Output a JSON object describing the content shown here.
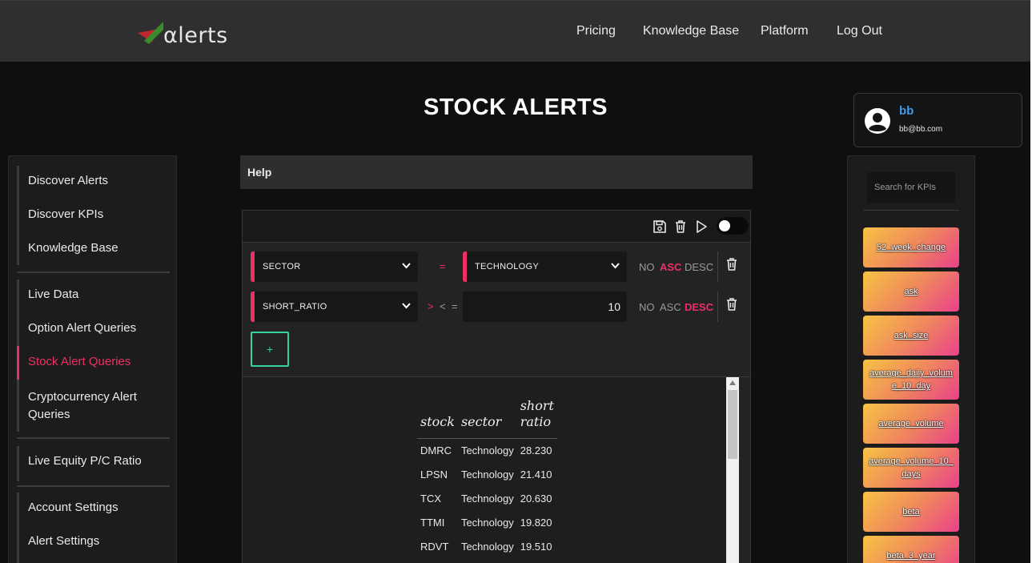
{
  "brand": {
    "logo_text": "αlerts"
  },
  "topnav": [
    "Pricing",
    "Knowledge Base",
    "Platform",
    "Log Out"
  ],
  "page": {
    "title": "STOCK ALERTS"
  },
  "user": {
    "name": "bb",
    "email": "bb@bb.com"
  },
  "sidebar": {
    "group1": [
      "Discover Alerts",
      "Discover KPIs",
      "Knowledge Base"
    ],
    "group2": [
      "Live Data",
      "Option Alert Queries",
      "Stock Alert Queries",
      "Cryptocurrency Alert Queries"
    ],
    "group3": [
      "Live Equity P/C Ratio"
    ],
    "group4": [
      "Account Settings",
      "Alert Settings"
    ],
    "active": "Stock Alert Queries"
  },
  "help": {
    "label": "Help"
  },
  "query": {
    "rows": [
      {
        "field": "SECTOR",
        "operators": [
          "="
        ],
        "active_operator": "=",
        "value": "TECHNOLOGY",
        "sort": [
          "NO",
          "ASC",
          "DESC"
        ],
        "active_sort": "ASC"
      },
      {
        "field": "SHORT_RATIO",
        "operators": [
          ">",
          "<",
          "="
        ],
        "active_operator": ">",
        "value": "10",
        "sort": [
          "NO",
          "ASC",
          "DESC"
        ],
        "active_sort": "DESC"
      }
    ],
    "add_label": "+"
  },
  "results": {
    "headers": [
      "stock",
      "sector",
      "short ratio"
    ],
    "rows": [
      [
        "DMRC",
        "Technology",
        "28.230"
      ],
      [
        "LPSN",
        "Technology",
        "21.410"
      ],
      [
        "TCX",
        "Technology",
        "20.630"
      ],
      [
        "TTMI",
        "Technology",
        "19.820"
      ],
      [
        "RDVT",
        "Technology",
        "19.510"
      ]
    ]
  },
  "kpis": {
    "search_placeholder": "Search for KPIs",
    "items": [
      "52_week_change",
      "ask",
      "ask_size",
      "average_daily_volume_10_day",
      "average_volume",
      "average_volume_10_days",
      "beta",
      "beta_3_year"
    ]
  },
  "colors": {
    "accent": "#ee2f66",
    "add": "#34d399",
    "user": "#3b9ae8"
  }
}
